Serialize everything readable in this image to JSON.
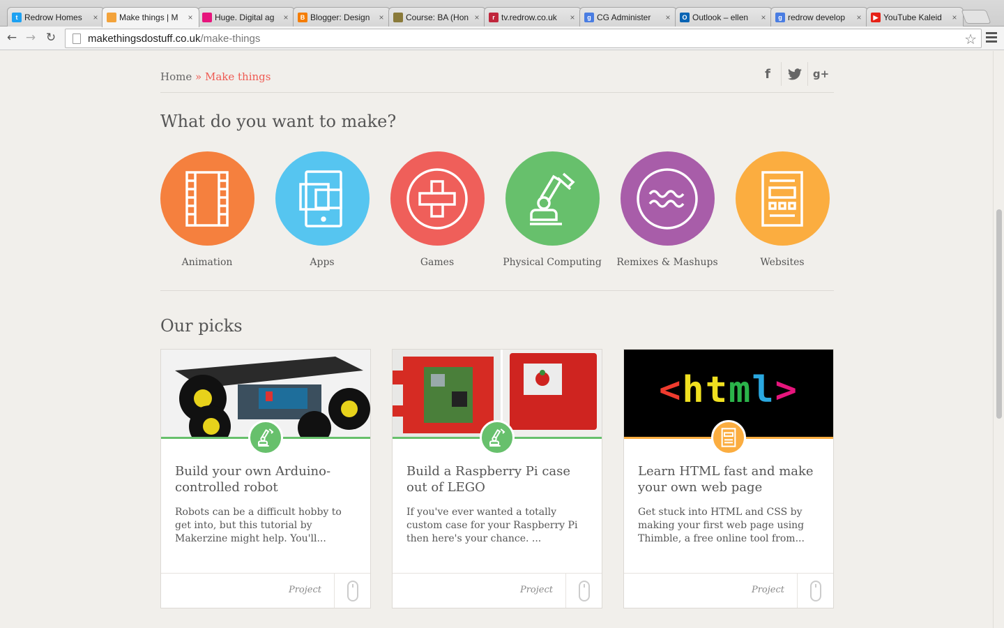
{
  "browser": {
    "tabs": [
      {
        "title": "Redrow Homes",
        "favicon": "twitter-icon",
        "color": "#1da1f2",
        "glyph": "t"
      },
      {
        "title": "Make things | M",
        "favicon": "cube-icon",
        "color": "#f3a33b",
        "glyph": ""
      },
      {
        "title": "Huge. Digital ag",
        "favicon": "pink-square-icon",
        "color": "#e6157c",
        "glyph": ""
      },
      {
        "title": "Blogger: Design",
        "favicon": "blogger-icon",
        "color": "#f57d00",
        "glyph": "B"
      },
      {
        "title": "Course: BA (Hon",
        "favicon": "crest-icon",
        "color": "#8a7a3a",
        "glyph": ""
      },
      {
        "title": "tv.redrow.co.uk",
        "favicon": "redrow-icon",
        "color": "#c0263c",
        "glyph": "r"
      },
      {
        "title": "CG Administer",
        "favicon": "google-icon",
        "color": "#4a7de2",
        "glyph": "g"
      },
      {
        "title": "Outlook – ellen",
        "favicon": "outlook-icon",
        "color": "#0a64b4",
        "glyph": "O"
      },
      {
        "title": "redrow develop",
        "favicon": "google-icon",
        "color": "#4a7de2",
        "glyph": "g"
      },
      {
        "title": "YouTube Kaleid",
        "favicon": "youtube-icon",
        "color": "#e62117",
        "glyph": "▶"
      }
    ],
    "url_domain": "makethingsdostuff.co.uk",
    "url_path": "/make-things"
  },
  "breadcrumb": {
    "home": "Home",
    "separator": "»",
    "current": "Make things"
  },
  "social": [
    "f",
    "t",
    "g+"
  ],
  "section_make": {
    "heading": "What do you want to make?",
    "categories": [
      {
        "label": "Animation",
        "color": "#f5803e",
        "icon": "film-icon"
      },
      {
        "label": "Apps",
        "color": "#56c5f0",
        "icon": "tablet-icon"
      },
      {
        "label": "Games",
        "color": "#ef5f5a",
        "icon": "dpad-icon"
      },
      {
        "label": "Physical Computing",
        "color": "#67c06c",
        "icon": "robot-arm-icon"
      },
      {
        "label": "Remixes & Mashups",
        "color": "#a85da9",
        "icon": "wave-icon"
      },
      {
        "label": "Websites",
        "color": "#fbad40",
        "icon": "webpage-icon"
      }
    ]
  },
  "section_picks": {
    "heading": "Our picks",
    "cards": [
      {
        "title": "Build your own Arduino-controlled robot",
        "desc": "Robots can be a difficult hobby to get into, but this tutorial by Makerzine might help. You'll...",
        "type": "Project",
        "accent": "#67c06c",
        "badge_icon": "robot-arm-icon"
      },
      {
        "title": "Build a Raspberry Pi case out of LEGO",
        "desc": "If you've ever wanted a totally custom case for your Raspberry Pi then here's your chance. ...",
        "type": "Project",
        "accent": "#67c06c",
        "badge_icon": "robot-arm-icon"
      },
      {
        "title": "Learn HTML fast and make your own web page",
        "desc": "Get stuck into HTML and CSS by making your first web page using Thimble, a free online tool from...",
        "type": "Project",
        "accent": "#fbad40",
        "badge_icon": "webpage-icon",
        "image_text": "<html>"
      }
    ]
  }
}
